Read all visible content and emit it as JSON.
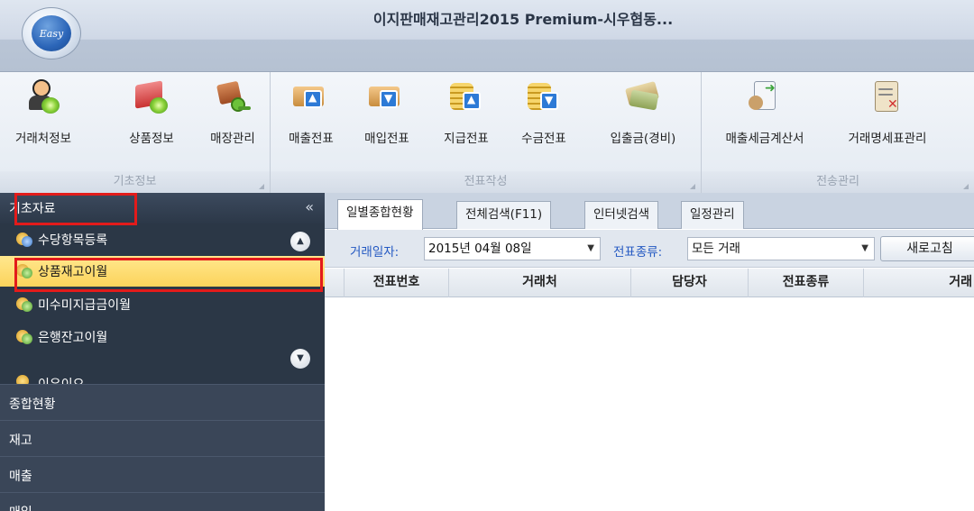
{
  "window": {
    "logo_text": "Easy",
    "title": "이지판매재고관리2015 Premium-시우협동..."
  },
  "ribbon": {
    "groups": [
      {
        "label": "기초정보",
        "buttons": [
          {
            "label": "거래처정보",
            "icon": "person-disc-icon"
          },
          {
            "label": "상품정보",
            "icon": "box-disc-icon"
          },
          {
            "label": "매장관리",
            "icon": "house-key-icon"
          }
        ]
      },
      {
        "label": "전표작성",
        "buttons": [
          {
            "label": "매출전표",
            "icon": "box-up-arrow-icon"
          },
          {
            "label": "매입전표",
            "icon": "box-down-arrow-icon"
          },
          {
            "label": "지급전표",
            "icon": "coins-up-arrow-icon"
          },
          {
            "label": "수금전표",
            "icon": "coins-down-arrow-icon"
          },
          {
            "label": "입출금(경비)",
            "icon": "money-stack-icon"
          }
        ]
      },
      {
        "label": "전송관리",
        "buttons": [
          {
            "label": "매출세금계산서",
            "icon": "document-send-icon"
          },
          {
            "label": "거래명세표관리",
            "icon": "clipboard-icon"
          }
        ]
      }
    ]
  },
  "sidebar": {
    "header": "기초자료",
    "collapse_glyph": "«",
    "items": [
      {
        "label": "수당항목등록",
        "icon": "coin-icon"
      },
      {
        "label": "상품재고이월",
        "icon": "coin-icon",
        "selected": true
      },
      {
        "label": "미수미지급금이월",
        "icon": "coin-icon"
      },
      {
        "label": "은행잔고이월",
        "icon": "coin-icon"
      },
      {
        "label": "이우이오",
        "icon": "coin-icon"
      }
    ],
    "scroll_up": "▲",
    "scroll_down": "▼",
    "sections": [
      "종합현황",
      "재고",
      "매출",
      "매입"
    ]
  },
  "main": {
    "tabs": [
      "일별종합현황",
      "전체검색(F11)",
      "인터넷검색",
      "일정관리"
    ],
    "active_tab": 0,
    "filters": {
      "date_label": "거래일자:",
      "date_value": "2015년 04월 08일",
      "type_label": "전표종류:",
      "type_value": "모든 거래",
      "dropdown_glyph": "▼",
      "refresh_label": "새로고침"
    },
    "grid_columns": [
      "",
      "전표번호",
      "거래처",
      "담당자",
      "전표종류",
      "거래"
    ]
  },
  "colors": {
    "highlight_box": "#e31b1b",
    "selected_item_bg": "#fcd35b",
    "sidebar_bg": "#2f3b4c",
    "filter_label": "#2459c2"
  }
}
